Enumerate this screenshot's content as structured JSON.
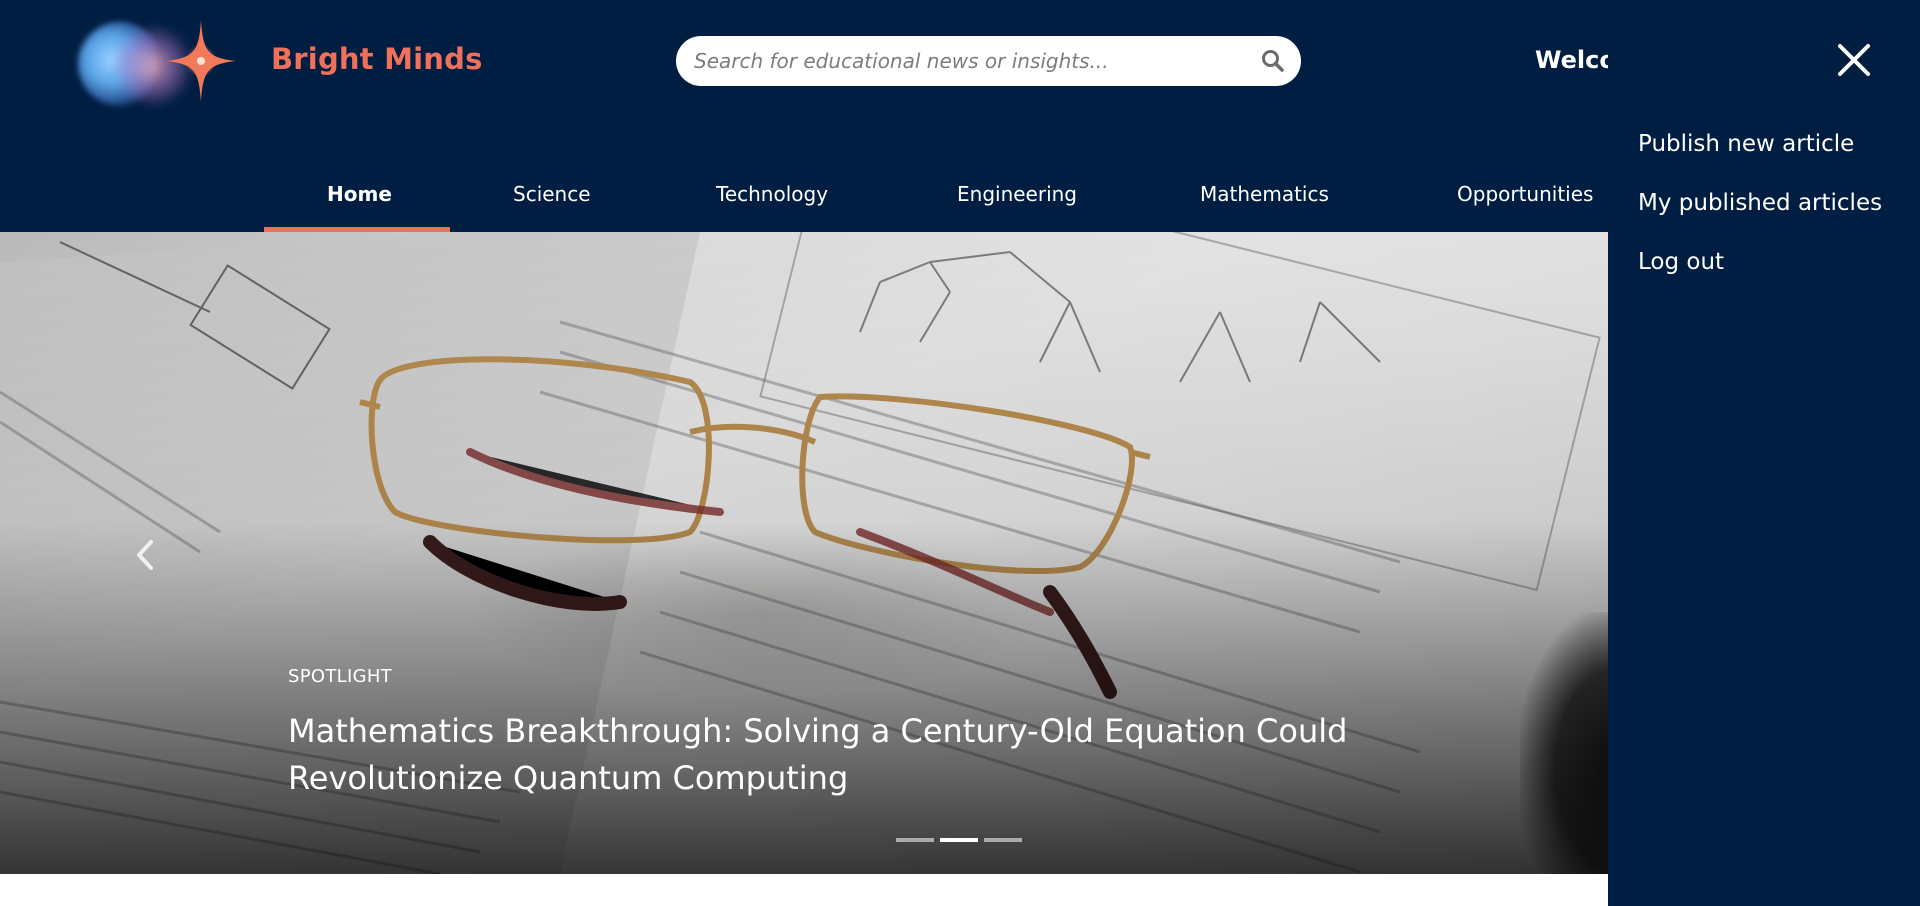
{
  "app": {
    "brand": "Bright Minds"
  },
  "search": {
    "placeholder": "Search for educational news or insights...",
    "icon": "search-icon"
  },
  "header": {
    "welcome_text": "Welco"
  },
  "nav": {
    "items": [
      {
        "label": "Home",
        "active": true
      },
      {
        "label": "Science",
        "active": false
      },
      {
        "label": "Technology",
        "active": false
      },
      {
        "label": "Engineering",
        "active": false
      },
      {
        "label": "Mathematics",
        "active": false
      },
      {
        "label": "Opportunities",
        "active": false
      }
    ]
  },
  "hero": {
    "tag": "SPOTLIGHT",
    "headline": "Mathematics Breakthrough: Solving a Century-Old Equation Could Revolutionize Quantum Computing",
    "slides_total": 3,
    "active_slide": 2,
    "prev_icon": "chevron-left-icon"
  },
  "panel": {
    "close_icon": "close-icon",
    "menu": [
      {
        "label": "Publish new article"
      },
      {
        "label": "My published articles"
      },
      {
        "label": "Log out"
      }
    ]
  },
  "colors": {
    "navy": "#001e42",
    "accent": "#f0705a",
    "white": "#ffffff"
  }
}
